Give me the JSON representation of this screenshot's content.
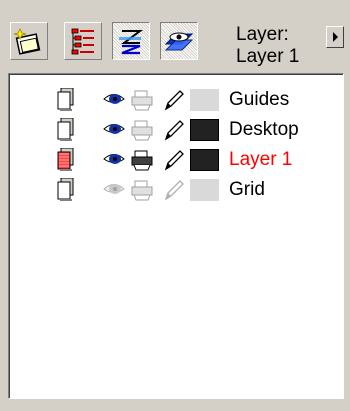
{
  "toolbar": {
    "buttons": [
      {
        "icon": "new-layer-icon"
      },
      {
        "icon": "layer-list-icon"
      },
      {
        "icon": "show-object-properties-icon"
      },
      {
        "icon": "edit-across-layers-icon"
      }
    ],
    "layer_caption": "Layer:",
    "layer_name": "Layer 1",
    "flyout_icon": "flyout-arrow-icon"
  },
  "layers": [
    {
      "name": "Guides",
      "visible": true,
      "printable": false,
      "editable": true,
      "swatch": "#d9d9d9",
      "active": false
    },
    {
      "name": "Desktop",
      "visible": true,
      "printable": false,
      "editable": true,
      "swatch": "#222222",
      "active": false
    },
    {
      "name": "Layer 1",
      "visible": true,
      "printable": true,
      "editable": true,
      "swatch": "#222222",
      "active": true,
      "text_color": "#ff0000"
    },
    {
      "name": "Grid",
      "visible": false,
      "printable": false,
      "editable": false,
      "swatch": "#d9d9d9",
      "active": false
    }
  ]
}
